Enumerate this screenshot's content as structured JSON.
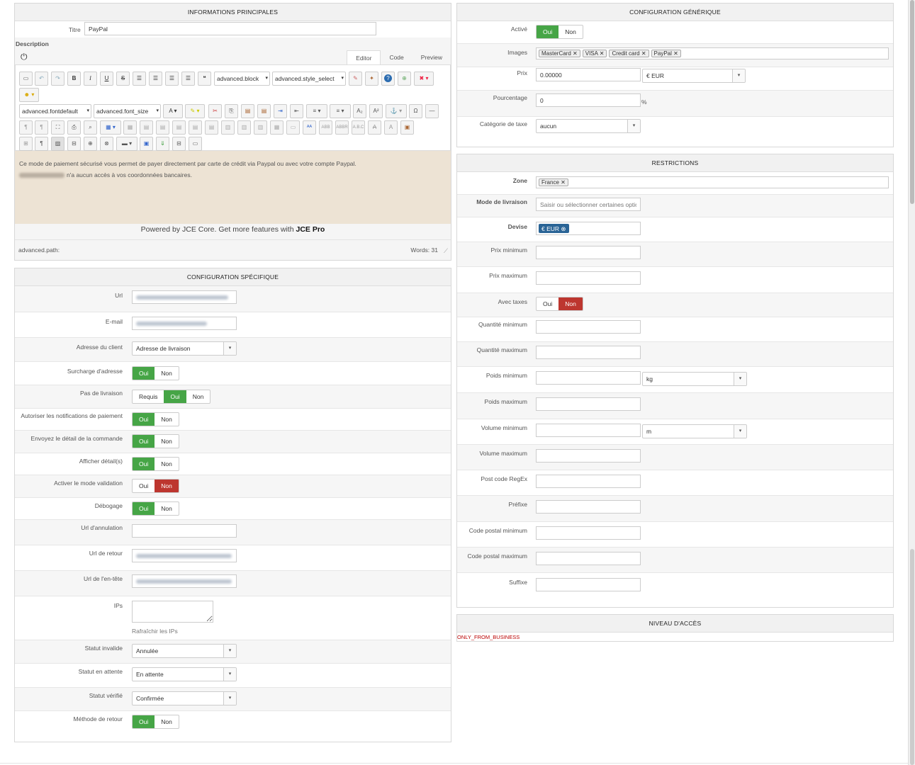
{
  "info": {
    "header": "INFORMATIONS PRINCIPALES",
    "title_label": "Titre",
    "title_value": "PayPal",
    "description_label": "Description",
    "editor_tabs": [
      "Editor",
      "Code",
      "Preview"
    ],
    "toolbar_selects": [
      "advanced.block",
      "advanced.style_select",
      "advanced.fontdefault",
      "advanced.font_size"
    ],
    "content_line1": "Ce mode de paiement sécurisé vous permet de payer directement par carte de crédit via Paypal ou avec votre compte Paypal.",
    "content_line2": "n'a aucun accès à vos coordonnées bancaires.",
    "powered_text": "Powered by JCE Core. Get more features with ",
    "powered_bold": "JCE Pro",
    "path_label": "advanced.path:",
    "word_count": "Words: 31"
  },
  "specific": {
    "header": "CONFIGURATION SPÉCIFIQUE",
    "url_label": "Url",
    "email_label": "E-mail",
    "address_label": "Adresse du client",
    "address_value": "Adresse de livraison",
    "address_override_label": "Surcharge d'adresse",
    "no_shipping_label": "Pas de livraison",
    "notifications_label": "Autoriser les notifications de paiement",
    "order_detail_label": "Envoyez le détail de la commande",
    "show_details_label": "Afficher détail(s)",
    "validation_mode_label": "Activer le mode validation",
    "debug_label": "Débogage",
    "cancel_url_label": "Url d'annulation",
    "return_url_label": "Url de retour",
    "header_url_label": "Url de l'en-tête",
    "ips_label": "IPs",
    "refresh_ips": "Rafraîchir les IPs",
    "invalid_status_label": "Statut invalide",
    "invalid_status_value": "Annulée",
    "pending_status_label": "Statut en attente",
    "pending_status_value": "En attente",
    "verified_status_label": "Statut vérifié",
    "verified_status_value": "Confirmée",
    "return_method_label": "Méthode de retour"
  },
  "toggle": {
    "yes": "Oui",
    "no": "Non",
    "required": "Requis"
  },
  "generic": {
    "header": "CONFIGURATION GÉNÉRIQUE",
    "active_label": "Activé",
    "images_label": "Images",
    "images": [
      "MasterCard",
      "VISA",
      "Credit card",
      "PayPal"
    ],
    "price_label": "Prix",
    "price_value": "0.00000",
    "currency_value": "€ EUR",
    "percent_label": "Pourcentage",
    "percent_value": "0",
    "percent_unit": "%",
    "tax_label": "Catégorie de taxe",
    "tax_value": "aucun"
  },
  "restrictions": {
    "header": "RESTRICTIONS",
    "zone_label": "Zone",
    "zone_tag": "France",
    "shipping_label": "Mode de livraison",
    "shipping_placeholder": "Saisir ou sélectionner certaines options",
    "currency_label": "Devise",
    "currency_tag": "€ EUR",
    "min_price_label": "Prix minimum",
    "max_price_label": "Prix maximum",
    "with_taxes_label": "Avec taxes",
    "min_qty_label": "Quantité minimum",
    "max_qty_label": "Quantité maximum",
    "min_weight_label": "Poids minimum",
    "weight_unit": "kg",
    "max_weight_label": "Poids maximum",
    "min_volume_label": "Volume minimum",
    "volume_unit": "m",
    "max_volume_label": "Volume maximum",
    "regex_label": "Post code RegEx",
    "prefix_label": "Préfixe",
    "min_postcode_label": "Code postal minimum",
    "max_postcode_label": "Code postal maximum",
    "suffix_label": "Suffixe"
  },
  "access": {
    "header": "NIVEAU D'ACCÈS",
    "value": "ONLY_FROM_BUSINESS"
  },
  "colors": {
    "green": "#46a546",
    "red": "#bd362f",
    "editor_bg": "#ede3d4",
    "tag_blue": "#2a6496"
  }
}
